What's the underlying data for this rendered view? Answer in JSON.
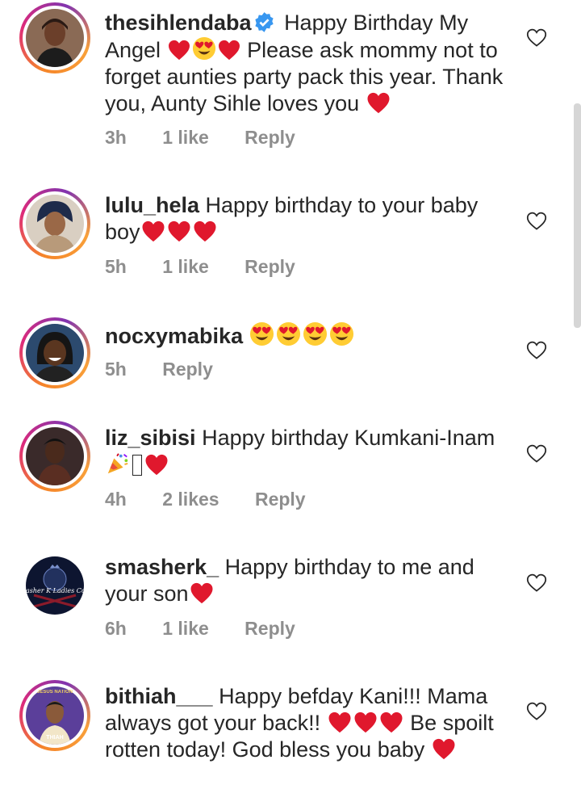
{
  "comments": [
    {
      "username": "thesihlendaba",
      "verified": true,
      "segments": [
        "Happy Birthday My Angel",
        "Please ask mommy not to forget aunties party pack this year. Thank you, Aunty Sihle loves you"
      ],
      "time": "3h",
      "likes": "1 like",
      "reply": "Reply",
      "avatar_icon": "profile-photo"
    },
    {
      "username": "lulu_hela",
      "text": "Happy birthday to your baby boy",
      "time": "5h",
      "likes": "1 like",
      "reply": "Reply",
      "avatar_icon": "profile-photo"
    },
    {
      "username": "nocxymabika",
      "text": "",
      "time": "5h",
      "likes": "",
      "reply": "Reply",
      "avatar_icon": "profile-photo"
    },
    {
      "username": "liz_sibisi",
      "text": "Happy birthday Kumkani-Inam",
      "time": "4h",
      "likes": "2 likes",
      "reply": "Reply",
      "avatar_icon": "profile-photo"
    },
    {
      "username": "smasherk_",
      "text": "Happy birthday to me and your son",
      "time": "6h",
      "likes": "1 like",
      "reply": "Reply",
      "avatar_text": "asher K Ladies Collect",
      "avatar_icon": "logo"
    },
    {
      "username": "bithiah___",
      "text": "Happy befday Kani!!! Mama always got your back!!",
      "text2": "Be spoilt rotten today! God bless you baby",
      "avatar_text": "JESUS NATION",
      "avatar_text2": "THIAH",
      "avatar_icon": "profile-photo"
    }
  ],
  "colors": {
    "heart": "#e0182d",
    "meta": "#8e8e8e",
    "verified": "#3897f0"
  }
}
